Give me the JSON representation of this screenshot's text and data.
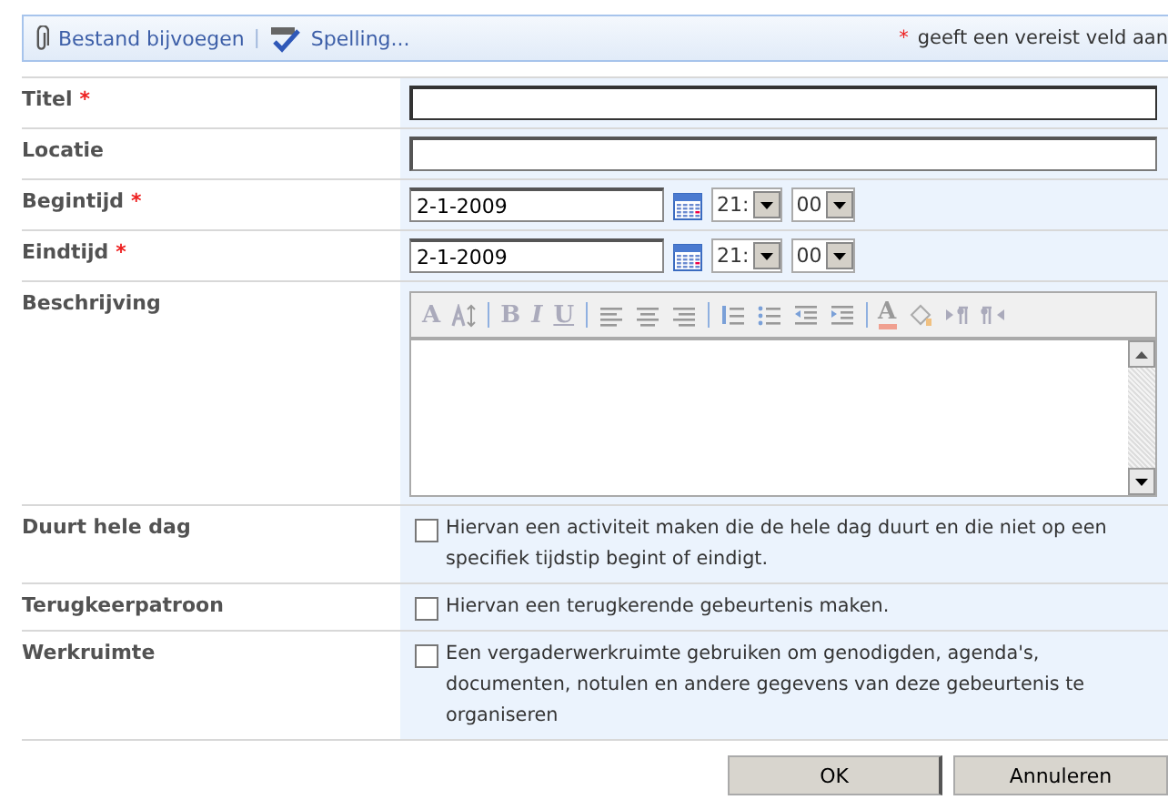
{
  "toolbar": {
    "attach": "Bestand bijvoegen",
    "separator": "|",
    "spelling": "Spelling...",
    "required_mark": "*",
    "required_note": "geeft een vereist veld aan"
  },
  "fields": [
    {
      "kind": "text",
      "label": "Titel",
      "required": true,
      "focused": true
    },
    {
      "kind": "text",
      "label": "Locatie",
      "required": false,
      "focused": false
    },
    {
      "kind": "datetime",
      "label": "Begintijd",
      "required": true,
      "date": "2-1-2009",
      "hour": "21:",
      "minute": "00"
    },
    {
      "kind": "datetime",
      "label": "Eindtijd",
      "required": true,
      "date": "2-1-2009",
      "hour": "21:",
      "minute": "00"
    },
    {
      "kind": "richtext",
      "label": "Beschrijving",
      "required": false,
      "glyphs": [
        "A",
        "B",
        "I",
        "U",
        "A"
      ]
    },
    {
      "kind": "checkbox",
      "label": "Duurt hele dag",
      "required": false,
      "checked": false,
      "text": "Hiervan een activiteit maken die de hele dag duurt en die niet op een specifiek tijdstip begint of eindigt."
    },
    {
      "kind": "checkbox",
      "label": "Terugkeerpatroon",
      "required": false,
      "checked": false,
      "text": "Hiervan een terugkerende gebeurtenis maken."
    },
    {
      "kind": "checkbox",
      "label": "Werkruimte",
      "required": false,
      "checked": false,
      "text": "Een vergaderwerkruimte gebruiken om genodigden, agenda's, documenten, notulen en andere gegevens van deze gebeurtenis te organiseren"
    }
  ],
  "buttons": [
    "OK",
    "Annuleren"
  ]
}
